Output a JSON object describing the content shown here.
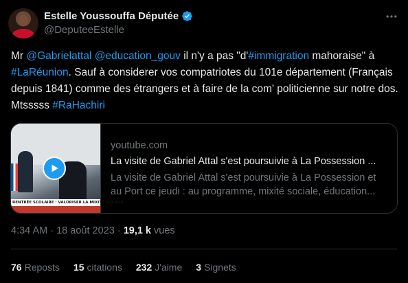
{
  "author": {
    "name": "Estelle Youssouffa Députée",
    "handle": "@DeputeeEstelle"
  },
  "tweet": {
    "segments": [
      {
        "text": "Mr ",
        "link": false
      },
      {
        "text": "@Gabrielattal",
        "link": true
      },
      {
        "text": " ",
        "link": false
      },
      {
        "text": "@education_gouv",
        "link": true
      },
      {
        "text": " il n'y a pas \"d'",
        "link": false
      },
      {
        "text": "#immigration",
        "link": true
      },
      {
        "text": " mahoraise\" à ",
        "link": false
      },
      {
        "text": "#LaRéunion",
        "link": true
      },
      {
        "text": ". Sauf à considerer vos compatriotes du 101e département (Français depuis 1841) comme des étrangers et à faire de la com' politicienne sur notre dos. Mtsssss ",
        "link": false
      },
      {
        "text": "#RaHachiri",
        "link": true
      }
    ]
  },
  "card": {
    "domain": "youtube.com",
    "title": "La visite de Gabriel Attal s'est poursuivie à La Possession ...",
    "description": "La visite de Gabriel Attal s'est poursuivie à La Possession et au Port ce jeudi : au programme, mixité sociale, éducation...",
    "thumbnail_banner": "RENTRÉE SCOLAIRE : VALORISER LA MIXITÉ SOCIALE"
  },
  "meta": {
    "time": "4:34 AM",
    "separator": "·",
    "date": "18 août 2023",
    "views_count": "19,1 k",
    "views_label": "vues"
  },
  "stats": {
    "reposts_count": "76",
    "reposts_label": "Reposts",
    "quotes_count": "15",
    "quotes_label": "citations",
    "likes_count": "232",
    "likes_label": "J'aime",
    "bookmarks_count": "3",
    "bookmarks_label": "Signets"
  },
  "colors": {
    "background": "#000000",
    "text": "#e7e9ea",
    "secondary": "#71767b",
    "link": "#1d9bf0",
    "border": "#2f3336"
  },
  "icons": [
    "verified-badge-icon",
    "more-options-icon",
    "play-icon"
  ]
}
